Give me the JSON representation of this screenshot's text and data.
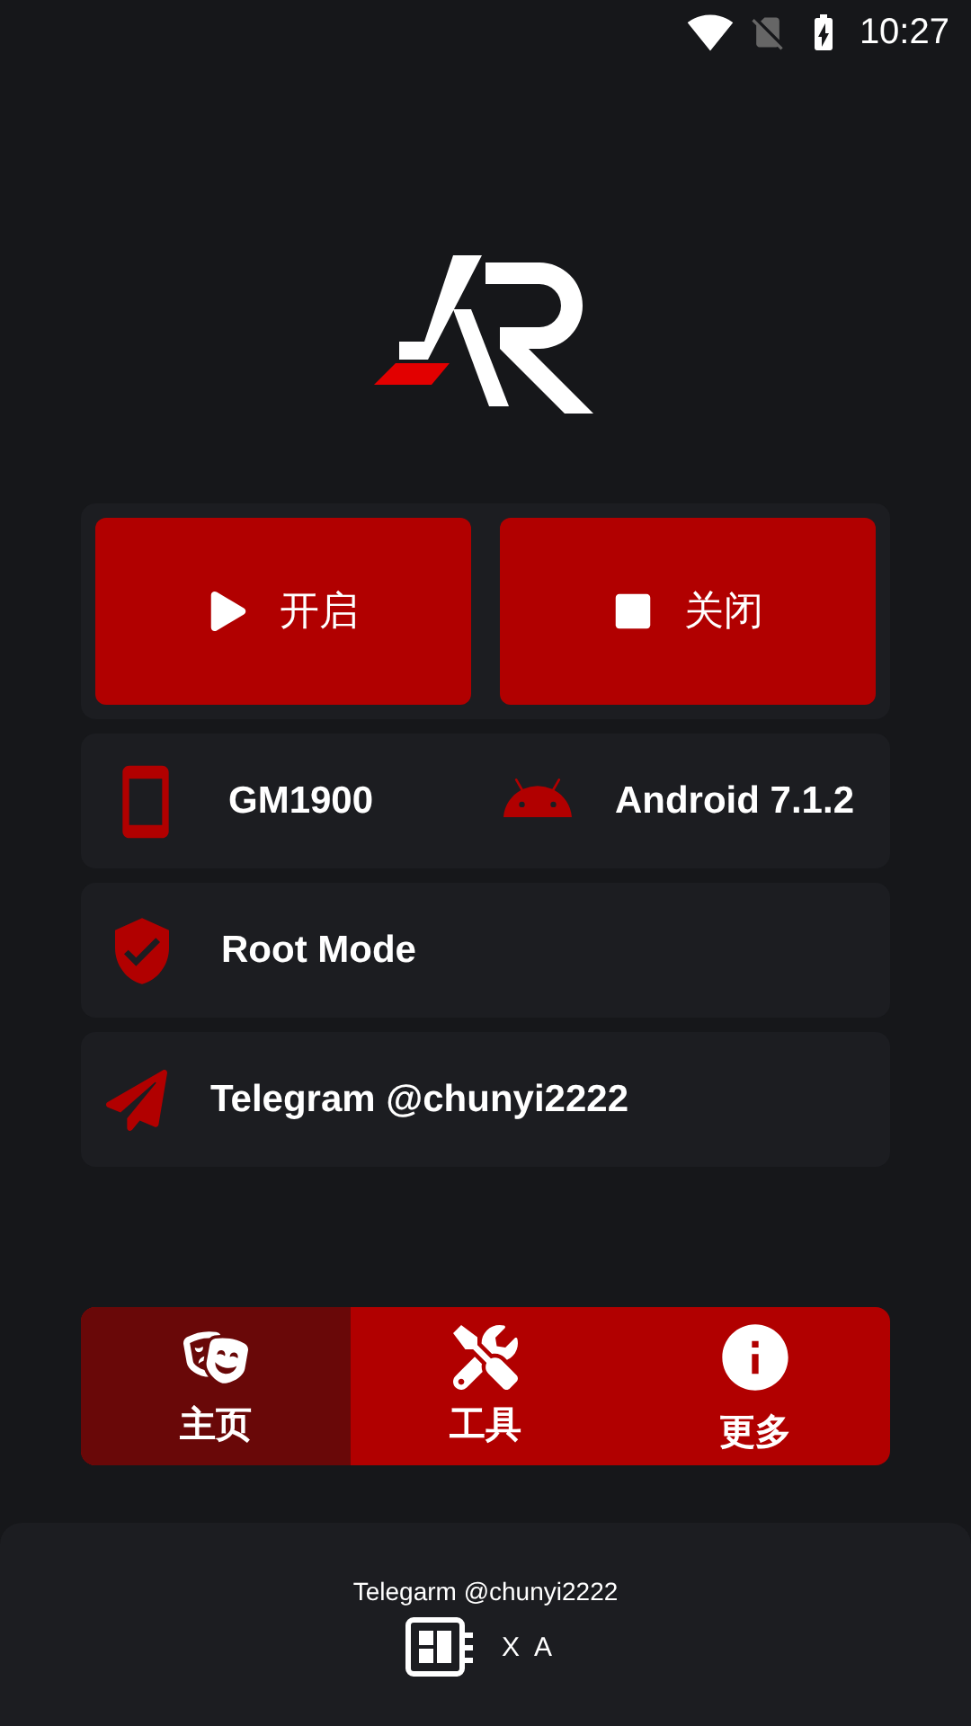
{
  "status_bar": {
    "time": "10:27"
  },
  "controls": [
    {
      "kind": "start",
      "label": "开启"
    },
    {
      "kind": "stop",
      "label": "关闭"
    }
  ],
  "device": {
    "model": "GM1900",
    "os": "Android 7.1.2"
  },
  "rows": [
    {
      "kind": "root",
      "label": "Root Mode"
    },
    {
      "kind": "telegram",
      "label": "Telegram @chunyi2222"
    }
  ],
  "tabs": [
    {
      "kind": "home",
      "label": "主页",
      "selected": true
    },
    {
      "kind": "tools",
      "label": "工具",
      "selected": false
    },
    {
      "kind": "more",
      "label": "更多",
      "selected": false
    }
  ],
  "footer": {
    "contact": "Telegarm @chunyi2222",
    "brand": "XA"
  }
}
